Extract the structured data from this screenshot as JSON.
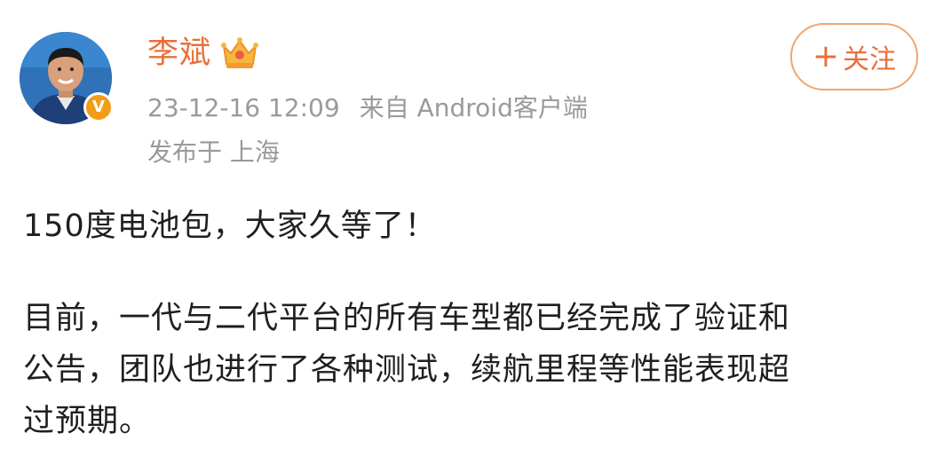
{
  "post": {
    "author": {
      "name": "李斌",
      "avatar_icon": "user-avatar",
      "verified_icon": "verified-v-icon",
      "verified_label": "V",
      "vip_icon": "crown-icon"
    },
    "meta": {
      "timestamp": "23-12-16 12:09",
      "source": "来自 Android客户端",
      "location": "发布于 上海"
    },
    "follow_button": {
      "label": "关注",
      "icon": "plus-icon",
      "plus": "+"
    },
    "content": {
      "paragraph_1": "150度电池包，大家久等了！",
      "paragraph_2_lines": [
        "目前，一代与二代平台的所有车型都已经完成了验证和",
        "公告，团队也进行了各种测试，续航里程等性能表现超",
        "过预期。"
      ]
    }
  },
  "colors": {
    "accent": "#e8703a",
    "accent_border": "#f0a66e",
    "meta_gray": "#9a9a9a",
    "text": "#1f1f1f",
    "badge": "#f39d16"
  }
}
